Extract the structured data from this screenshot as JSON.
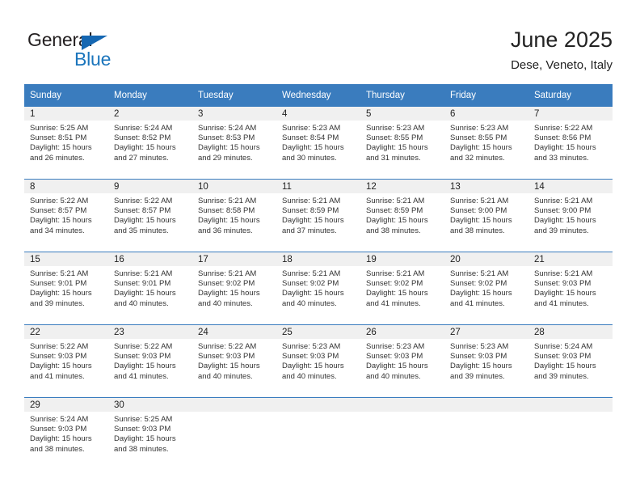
{
  "brand": {
    "name_part1": "General",
    "name_part2": "Blue",
    "flag_color": "#1567b2",
    "blue_color": "#1b75bc"
  },
  "header": {
    "title": "June 2025",
    "location": "Dese, Veneto, Italy"
  },
  "theme": {
    "header_blue": "#3a7cbe",
    "daynum_band": "#f0f0f0",
    "separator_blue": "#3a7cbe"
  },
  "weekdays": [
    "Sunday",
    "Monday",
    "Tuesday",
    "Wednesday",
    "Thursday",
    "Friday",
    "Saturday"
  ],
  "weeks": [
    [
      {
        "day": "1",
        "sunrise": "Sunrise: 5:25 AM",
        "sunset": "Sunset: 8:51 PM",
        "daylight1": "Daylight: 15 hours",
        "daylight2": "and 26 minutes."
      },
      {
        "day": "2",
        "sunrise": "Sunrise: 5:24 AM",
        "sunset": "Sunset: 8:52 PM",
        "daylight1": "Daylight: 15 hours",
        "daylight2": "and 27 minutes."
      },
      {
        "day": "3",
        "sunrise": "Sunrise: 5:24 AM",
        "sunset": "Sunset: 8:53 PM",
        "daylight1": "Daylight: 15 hours",
        "daylight2": "and 29 minutes."
      },
      {
        "day": "4",
        "sunrise": "Sunrise: 5:23 AM",
        "sunset": "Sunset: 8:54 PM",
        "daylight1": "Daylight: 15 hours",
        "daylight2": "and 30 minutes."
      },
      {
        "day": "5",
        "sunrise": "Sunrise: 5:23 AM",
        "sunset": "Sunset: 8:55 PM",
        "daylight1": "Daylight: 15 hours",
        "daylight2": "and 31 minutes."
      },
      {
        "day": "6",
        "sunrise": "Sunrise: 5:23 AM",
        "sunset": "Sunset: 8:55 PM",
        "daylight1": "Daylight: 15 hours",
        "daylight2": "and 32 minutes."
      },
      {
        "day": "7",
        "sunrise": "Sunrise: 5:22 AM",
        "sunset": "Sunset: 8:56 PM",
        "daylight1": "Daylight: 15 hours",
        "daylight2": "and 33 minutes."
      }
    ],
    [
      {
        "day": "8",
        "sunrise": "Sunrise: 5:22 AM",
        "sunset": "Sunset: 8:57 PM",
        "daylight1": "Daylight: 15 hours",
        "daylight2": "and 34 minutes."
      },
      {
        "day": "9",
        "sunrise": "Sunrise: 5:22 AM",
        "sunset": "Sunset: 8:57 PM",
        "daylight1": "Daylight: 15 hours",
        "daylight2": "and 35 minutes."
      },
      {
        "day": "10",
        "sunrise": "Sunrise: 5:21 AM",
        "sunset": "Sunset: 8:58 PM",
        "daylight1": "Daylight: 15 hours",
        "daylight2": "and 36 minutes."
      },
      {
        "day": "11",
        "sunrise": "Sunrise: 5:21 AM",
        "sunset": "Sunset: 8:59 PM",
        "daylight1": "Daylight: 15 hours",
        "daylight2": "and 37 minutes."
      },
      {
        "day": "12",
        "sunrise": "Sunrise: 5:21 AM",
        "sunset": "Sunset: 8:59 PM",
        "daylight1": "Daylight: 15 hours",
        "daylight2": "and 38 minutes."
      },
      {
        "day": "13",
        "sunrise": "Sunrise: 5:21 AM",
        "sunset": "Sunset: 9:00 PM",
        "daylight1": "Daylight: 15 hours",
        "daylight2": "and 38 minutes."
      },
      {
        "day": "14",
        "sunrise": "Sunrise: 5:21 AM",
        "sunset": "Sunset: 9:00 PM",
        "daylight1": "Daylight: 15 hours",
        "daylight2": "and 39 minutes."
      }
    ],
    [
      {
        "day": "15",
        "sunrise": "Sunrise: 5:21 AM",
        "sunset": "Sunset: 9:01 PM",
        "daylight1": "Daylight: 15 hours",
        "daylight2": "and 39 minutes."
      },
      {
        "day": "16",
        "sunrise": "Sunrise: 5:21 AM",
        "sunset": "Sunset: 9:01 PM",
        "daylight1": "Daylight: 15 hours",
        "daylight2": "and 40 minutes."
      },
      {
        "day": "17",
        "sunrise": "Sunrise: 5:21 AM",
        "sunset": "Sunset: 9:02 PM",
        "daylight1": "Daylight: 15 hours",
        "daylight2": "and 40 minutes."
      },
      {
        "day": "18",
        "sunrise": "Sunrise: 5:21 AM",
        "sunset": "Sunset: 9:02 PM",
        "daylight1": "Daylight: 15 hours",
        "daylight2": "and 40 minutes."
      },
      {
        "day": "19",
        "sunrise": "Sunrise: 5:21 AM",
        "sunset": "Sunset: 9:02 PM",
        "daylight1": "Daylight: 15 hours",
        "daylight2": "and 41 minutes."
      },
      {
        "day": "20",
        "sunrise": "Sunrise: 5:21 AM",
        "sunset": "Sunset: 9:02 PM",
        "daylight1": "Daylight: 15 hours",
        "daylight2": "and 41 minutes."
      },
      {
        "day": "21",
        "sunrise": "Sunrise: 5:21 AM",
        "sunset": "Sunset: 9:03 PM",
        "daylight1": "Daylight: 15 hours",
        "daylight2": "and 41 minutes."
      }
    ],
    [
      {
        "day": "22",
        "sunrise": "Sunrise: 5:22 AM",
        "sunset": "Sunset: 9:03 PM",
        "daylight1": "Daylight: 15 hours",
        "daylight2": "and 41 minutes."
      },
      {
        "day": "23",
        "sunrise": "Sunrise: 5:22 AM",
        "sunset": "Sunset: 9:03 PM",
        "daylight1": "Daylight: 15 hours",
        "daylight2": "and 41 minutes."
      },
      {
        "day": "24",
        "sunrise": "Sunrise: 5:22 AM",
        "sunset": "Sunset: 9:03 PM",
        "daylight1": "Daylight: 15 hours",
        "daylight2": "and 40 minutes."
      },
      {
        "day": "25",
        "sunrise": "Sunrise: 5:23 AM",
        "sunset": "Sunset: 9:03 PM",
        "daylight1": "Daylight: 15 hours",
        "daylight2": "and 40 minutes."
      },
      {
        "day": "26",
        "sunrise": "Sunrise: 5:23 AM",
        "sunset": "Sunset: 9:03 PM",
        "daylight1": "Daylight: 15 hours",
        "daylight2": "and 40 minutes."
      },
      {
        "day": "27",
        "sunrise": "Sunrise: 5:23 AM",
        "sunset": "Sunset: 9:03 PM",
        "daylight1": "Daylight: 15 hours",
        "daylight2": "and 39 minutes."
      },
      {
        "day": "28",
        "sunrise": "Sunrise: 5:24 AM",
        "sunset": "Sunset: 9:03 PM",
        "daylight1": "Daylight: 15 hours",
        "daylight2": "and 39 minutes."
      }
    ],
    [
      {
        "day": "29",
        "sunrise": "Sunrise: 5:24 AM",
        "sunset": "Sunset: 9:03 PM",
        "daylight1": "Daylight: 15 hours",
        "daylight2": "and 38 minutes."
      },
      {
        "day": "30",
        "sunrise": "Sunrise: 5:25 AM",
        "sunset": "Sunset: 9:03 PM",
        "daylight1": "Daylight: 15 hours",
        "daylight2": "and 38 minutes."
      },
      {
        "day": "",
        "sunrise": "",
        "sunset": "",
        "daylight1": "",
        "daylight2": ""
      },
      {
        "day": "",
        "sunrise": "",
        "sunset": "",
        "daylight1": "",
        "daylight2": ""
      },
      {
        "day": "",
        "sunrise": "",
        "sunset": "",
        "daylight1": "",
        "daylight2": ""
      },
      {
        "day": "",
        "sunrise": "",
        "sunset": "",
        "daylight1": "",
        "daylight2": ""
      },
      {
        "day": "",
        "sunrise": "",
        "sunset": "",
        "daylight1": "",
        "daylight2": ""
      }
    ]
  ]
}
